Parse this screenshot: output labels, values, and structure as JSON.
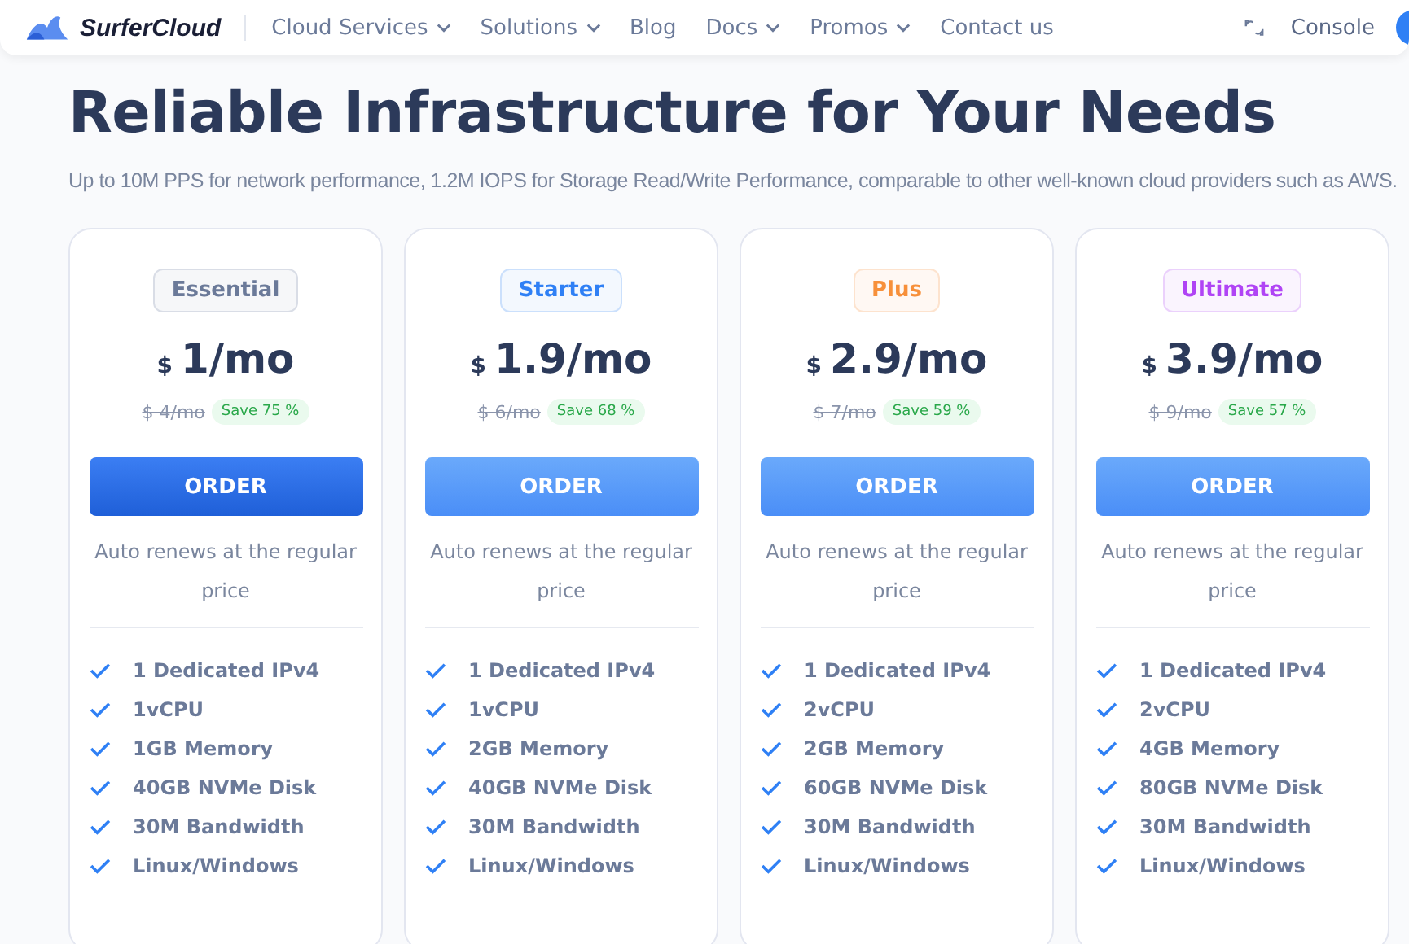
{
  "nav": {
    "brand": "SurferCloud",
    "items": [
      {
        "label": "Cloud Services",
        "dropdown": true
      },
      {
        "label": "Solutions",
        "dropdown": true
      },
      {
        "label": "Blog",
        "dropdown": false
      },
      {
        "label": "Docs",
        "dropdown": true
      },
      {
        "label": "Promos",
        "dropdown": true
      },
      {
        "label": "Contact us",
        "dropdown": false
      }
    ],
    "console": "Console"
  },
  "heading": "Reliable Infrastructure for Your Needs",
  "subtitle": "Up to 10M PPS for network performance, 1.2M IOPS for Storage Read/Write Performance, comparable to other well-known cloud providers such as AWS.",
  "plans": [
    {
      "tier": "Essential",
      "color": "#6b7a99",
      "currency": "$",
      "price": "1/mo",
      "old_price": "$ 4/mo",
      "save": "Save 75 %",
      "button": "ORDER",
      "selected": true,
      "note": "Auto renews at the regular price",
      "features": [
        "1 Dedicated IPv4",
        "1vCPU",
        "1GB Memory",
        "40GB NVMe Disk",
        "30M Bandwidth",
        "Linux/Windows"
      ]
    },
    {
      "tier": "Starter",
      "color": "#2f80f5",
      "currency": "$",
      "price": "1.9/mo",
      "old_price": "$ 6/mo",
      "save": "Save 68 %",
      "button": "ORDER",
      "selected": false,
      "note": "Auto renews at the regular price",
      "features": [
        "1 Dedicated IPv4",
        "1vCPU",
        "2GB Memory",
        "40GB NVMe Disk",
        "30M Bandwidth",
        "Linux/Windows"
      ]
    },
    {
      "tier": "Plus",
      "color": "#f7903a",
      "currency": "$",
      "price": "2.9/mo",
      "old_price": "$ 7/mo",
      "save": "Save 59 %",
      "button": "ORDER",
      "selected": false,
      "note": "Auto renews at the regular price",
      "features": [
        "1 Dedicated IPv4",
        "2vCPU",
        "2GB Memory",
        "60GB NVMe Disk",
        "30M Bandwidth",
        "Linux/Windows"
      ]
    },
    {
      "tier": "Ultimate",
      "color": "#b044f5",
      "currency": "$",
      "price": "3.9/mo",
      "old_price": "$ 9/mo",
      "save": "Save 57 %",
      "button": "ORDER",
      "selected": false,
      "note": "Auto renews at the regular price",
      "features": [
        "1 Dedicated IPv4",
        "2vCPU",
        "4GB Memory",
        "80GB NVMe Disk",
        "30M Bandwidth",
        "Linux/Windows"
      ]
    }
  ]
}
